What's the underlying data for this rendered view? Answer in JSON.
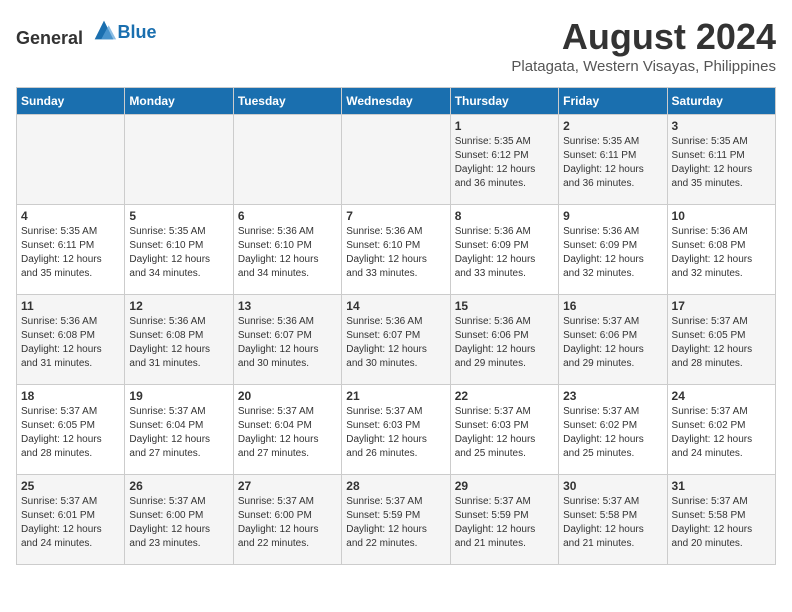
{
  "header": {
    "logo_general": "General",
    "logo_blue": "Blue",
    "title": "August 2024",
    "subtitle": "Platagata, Western Visayas, Philippines"
  },
  "days_of_week": [
    "Sunday",
    "Monday",
    "Tuesday",
    "Wednesday",
    "Thursday",
    "Friday",
    "Saturday"
  ],
  "weeks": [
    [
      {
        "day": "",
        "sunrise": "",
        "sunset": "",
        "daylight": ""
      },
      {
        "day": "",
        "sunrise": "",
        "sunset": "",
        "daylight": ""
      },
      {
        "day": "",
        "sunrise": "",
        "sunset": "",
        "daylight": ""
      },
      {
        "day": "",
        "sunrise": "",
        "sunset": "",
        "daylight": ""
      },
      {
        "day": "1",
        "sunrise": "5:35 AM",
        "sunset": "6:12 PM",
        "daylight": "12 hours and 36 minutes."
      },
      {
        "day": "2",
        "sunrise": "5:35 AM",
        "sunset": "6:11 PM",
        "daylight": "12 hours and 36 minutes."
      },
      {
        "day": "3",
        "sunrise": "5:35 AM",
        "sunset": "6:11 PM",
        "daylight": "12 hours and 35 minutes."
      }
    ],
    [
      {
        "day": "4",
        "sunrise": "5:35 AM",
        "sunset": "6:11 PM",
        "daylight": "12 hours and 35 minutes."
      },
      {
        "day": "5",
        "sunrise": "5:35 AM",
        "sunset": "6:10 PM",
        "daylight": "12 hours and 34 minutes."
      },
      {
        "day": "6",
        "sunrise": "5:36 AM",
        "sunset": "6:10 PM",
        "daylight": "12 hours and 34 minutes."
      },
      {
        "day": "7",
        "sunrise": "5:36 AM",
        "sunset": "6:10 PM",
        "daylight": "12 hours and 33 minutes."
      },
      {
        "day": "8",
        "sunrise": "5:36 AM",
        "sunset": "6:09 PM",
        "daylight": "12 hours and 33 minutes."
      },
      {
        "day": "9",
        "sunrise": "5:36 AM",
        "sunset": "6:09 PM",
        "daylight": "12 hours and 32 minutes."
      },
      {
        "day": "10",
        "sunrise": "5:36 AM",
        "sunset": "6:08 PM",
        "daylight": "12 hours and 32 minutes."
      }
    ],
    [
      {
        "day": "11",
        "sunrise": "5:36 AM",
        "sunset": "6:08 PM",
        "daylight": "12 hours and 31 minutes."
      },
      {
        "day": "12",
        "sunrise": "5:36 AM",
        "sunset": "6:08 PM",
        "daylight": "12 hours and 31 minutes."
      },
      {
        "day": "13",
        "sunrise": "5:36 AM",
        "sunset": "6:07 PM",
        "daylight": "12 hours and 30 minutes."
      },
      {
        "day": "14",
        "sunrise": "5:36 AM",
        "sunset": "6:07 PM",
        "daylight": "12 hours and 30 minutes."
      },
      {
        "day": "15",
        "sunrise": "5:36 AM",
        "sunset": "6:06 PM",
        "daylight": "12 hours and 29 minutes."
      },
      {
        "day": "16",
        "sunrise": "5:37 AM",
        "sunset": "6:06 PM",
        "daylight": "12 hours and 29 minutes."
      },
      {
        "day": "17",
        "sunrise": "5:37 AM",
        "sunset": "6:05 PM",
        "daylight": "12 hours and 28 minutes."
      }
    ],
    [
      {
        "day": "18",
        "sunrise": "5:37 AM",
        "sunset": "6:05 PM",
        "daylight": "12 hours and 28 minutes."
      },
      {
        "day": "19",
        "sunrise": "5:37 AM",
        "sunset": "6:04 PM",
        "daylight": "12 hours and 27 minutes."
      },
      {
        "day": "20",
        "sunrise": "5:37 AM",
        "sunset": "6:04 PM",
        "daylight": "12 hours and 27 minutes."
      },
      {
        "day": "21",
        "sunrise": "5:37 AM",
        "sunset": "6:03 PM",
        "daylight": "12 hours and 26 minutes."
      },
      {
        "day": "22",
        "sunrise": "5:37 AM",
        "sunset": "6:03 PM",
        "daylight": "12 hours and 25 minutes."
      },
      {
        "day": "23",
        "sunrise": "5:37 AM",
        "sunset": "6:02 PM",
        "daylight": "12 hours and 25 minutes."
      },
      {
        "day": "24",
        "sunrise": "5:37 AM",
        "sunset": "6:02 PM",
        "daylight": "12 hours and 24 minutes."
      }
    ],
    [
      {
        "day": "25",
        "sunrise": "5:37 AM",
        "sunset": "6:01 PM",
        "daylight": "12 hours and 24 minutes."
      },
      {
        "day": "26",
        "sunrise": "5:37 AM",
        "sunset": "6:00 PM",
        "daylight": "12 hours and 23 minutes."
      },
      {
        "day": "27",
        "sunrise": "5:37 AM",
        "sunset": "6:00 PM",
        "daylight": "12 hours and 22 minutes."
      },
      {
        "day": "28",
        "sunrise": "5:37 AM",
        "sunset": "5:59 PM",
        "daylight": "12 hours and 22 minutes."
      },
      {
        "day": "29",
        "sunrise": "5:37 AM",
        "sunset": "5:59 PM",
        "daylight": "12 hours and 21 minutes."
      },
      {
        "day": "30",
        "sunrise": "5:37 AM",
        "sunset": "5:58 PM",
        "daylight": "12 hours and 21 minutes."
      },
      {
        "day": "31",
        "sunrise": "5:37 AM",
        "sunset": "5:58 PM",
        "daylight": "12 hours and 20 minutes."
      }
    ]
  ]
}
